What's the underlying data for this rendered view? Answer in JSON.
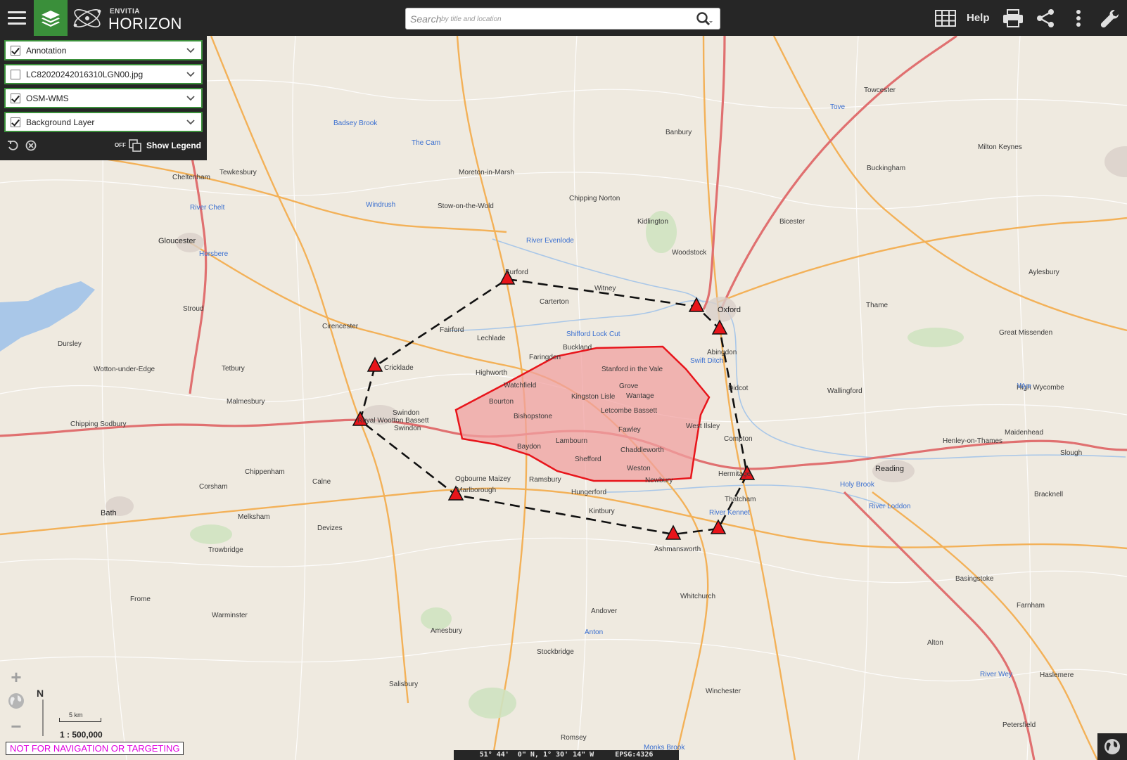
{
  "topbar": {
    "brand_sub": "ENVITIA",
    "brand_main": "HORIZON",
    "search_placeholder": "Search",
    "search_hint": "by title and location",
    "help_label": "Help",
    "icons": [
      "menu-icon",
      "layers-icon",
      "search-icon",
      "grid-icon",
      "print-icon",
      "share-icon",
      "more-icon",
      "wrench-icon"
    ]
  },
  "layers": [
    {
      "name": "Annotation",
      "checked": true
    },
    {
      "name": "LC82020242016310LGN00.jpg",
      "checked": false
    },
    {
      "name": "OSM-WMS",
      "checked": true
    },
    {
      "name": "Background Layer",
      "checked": true
    }
  ],
  "legend": {
    "toggle_state": "OFF",
    "label": "Show Legend"
  },
  "map": {
    "scale_km": "5 km",
    "scale_ratio": "1 : 500,000",
    "north_label": "N",
    "warning": "NOT FOR NAVIGATION OR TARGETING",
    "coords": {
      "lat": "51° 44'  0\" N,",
      "lon": "1° 30' 14\" W",
      "epsg": "EPSG:4326"
    },
    "zoom_in": "+",
    "zoom_out": "−",
    "colors": {
      "polygon_fill": "#f0a0a0",
      "polygon_stroke": "#e8151b",
      "marker": "#e8151b",
      "path": "#111111",
      "motorway": "#e07070",
      "primary_road": "#f3b158",
      "water": "#a9c7e8"
    },
    "places": [
      {
        "name": "Oxford",
        "big": true
      },
      {
        "name": "Abingdon"
      },
      {
        "name": "Didcot"
      },
      {
        "name": "Wantage"
      },
      {
        "name": "Grove"
      },
      {
        "name": "Stanford in the Vale"
      },
      {
        "name": "Kingston Lisle"
      },
      {
        "name": "Letcombe Bassett"
      },
      {
        "name": "Fawley"
      },
      {
        "name": "Chaddleworth"
      },
      {
        "name": "Lambourn"
      },
      {
        "name": "Weston"
      },
      {
        "name": "Baydon"
      },
      {
        "name": "Bishopstone"
      },
      {
        "name": "Bourton"
      },
      {
        "name": "Watchfield"
      },
      {
        "name": "Faringdon"
      },
      {
        "name": "Buckland"
      },
      {
        "name": "Highworth"
      },
      {
        "name": "Lechlade"
      },
      {
        "name": "Fairford"
      },
      {
        "name": "Burford"
      },
      {
        "name": "Witney"
      },
      {
        "name": "Carterton"
      },
      {
        "name": "Cricklade"
      },
      {
        "name": "Royal Wootton Bassett"
      },
      {
        "name": "Marlborough"
      },
      {
        "name": "Hungerford"
      },
      {
        "name": "Newbury"
      },
      {
        "name": "Thatcham"
      },
      {
        "name": "Reading",
        "big": true
      },
      {
        "name": "Wallingford"
      },
      {
        "name": "Henley-on-Thames"
      },
      {
        "name": "Swindon"
      },
      {
        "name": "Chippenham"
      },
      {
        "name": "Cirencester"
      },
      {
        "name": "Tetbury"
      },
      {
        "name": "Malmesbury"
      },
      {
        "name": "Stroud"
      },
      {
        "name": "Gloucester",
        "big": true
      },
      {
        "name": "Cheltenham"
      },
      {
        "name": "Tewkesbury"
      },
      {
        "name": "Stow-on-the-Wold"
      },
      {
        "name": "Moreton-in-Marsh"
      },
      {
        "name": "Chipping Norton"
      },
      {
        "name": "Banbury"
      },
      {
        "name": "Bicester"
      },
      {
        "name": "Thame"
      },
      {
        "name": "Aylesbury"
      },
      {
        "name": "Buckingham"
      },
      {
        "name": "Towcester"
      },
      {
        "name": "Milton Keynes"
      },
      {
        "name": "High Wycombe"
      },
      {
        "name": "Maidenhead"
      },
      {
        "name": "Slough"
      },
      {
        "name": "Bracknell"
      },
      {
        "name": "Basingstoke"
      },
      {
        "name": "Andover"
      },
      {
        "name": "Winchester"
      },
      {
        "name": "Salisbury"
      },
      {
        "name": "Devizes"
      },
      {
        "name": "Trowbridge"
      },
      {
        "name": "Bath",
        "big": true
      },
      {
        "name": "Frome"
      },
      {
        "name": "Warminster"
      },
      {
        "name": "Amesbury"
      },
      {
        "name": "Romsey"
      },
      {
        "name": "Alton"
      },
      {
        "name": "Farnham"
      },
      {
        "name": "Petersfield"
      },
      {
        "name": "Haslemere"
      },
      {
        "name": "Woodstock"
      },
      {
        "name": "Kidlington"
      },
      {
        "name": "Swindon"
      },
      {
        "name": "Calne"
      },
      {
        "name": "Corsham"
      },
      {
        "name": "Melksham"
      },
      {
        "name": "Stockbridge"
      },
      {
        "name": "Whitchurch"
      },
      {
        "name": "Ashmansworth"
      },
      {
        "name": "Kintbury"
      },
      {
        "name": "Ramsbury"
      },
      {
        "name": "Ogbourne Maizey"
      },
      {
        "name": "Hermitage"
      },
      {
        "name": "Compton"
      },
      {
        "name": "West Ilsley"
      },
      {
        "name": "Shefford"
      },
      {
        "name": "Great Missenden"
      },
      {
        "name": "Chipping Sodbury"
      },
      {
        "name": "Dursley"
      },
      {
        "name": "Wotton-under-Edge"
      }
    ],
    "water_labels": [
      {
        "name": "River Chelt"
      },
      {
        "name": "Windrush"
      },
      {
        "name": "River Evenlode"
      },
      {
        "name": "Shifford Lock Cut"
      },
      {
        "name": "Swift Ditch"
      },
      {
        "name": "River Kennet"
      },
      {
        "name": "Holy Brook"
      },
      {
        "name": "River Loddon"
      },
      {
        "name": "Horsbere"
      },
      {
        "name": "Badsey Brook"
      },
      {
        "name": "The Cam"
      },
      {
        "name": "River Wey"
      },
      {
        "name": "Monks Brook"
      },
      {
        "name": "Anton"
      },
      {
        "name": "Tove"
      },
      {
        "name": "Wye"
      }
    ]
  }
}
